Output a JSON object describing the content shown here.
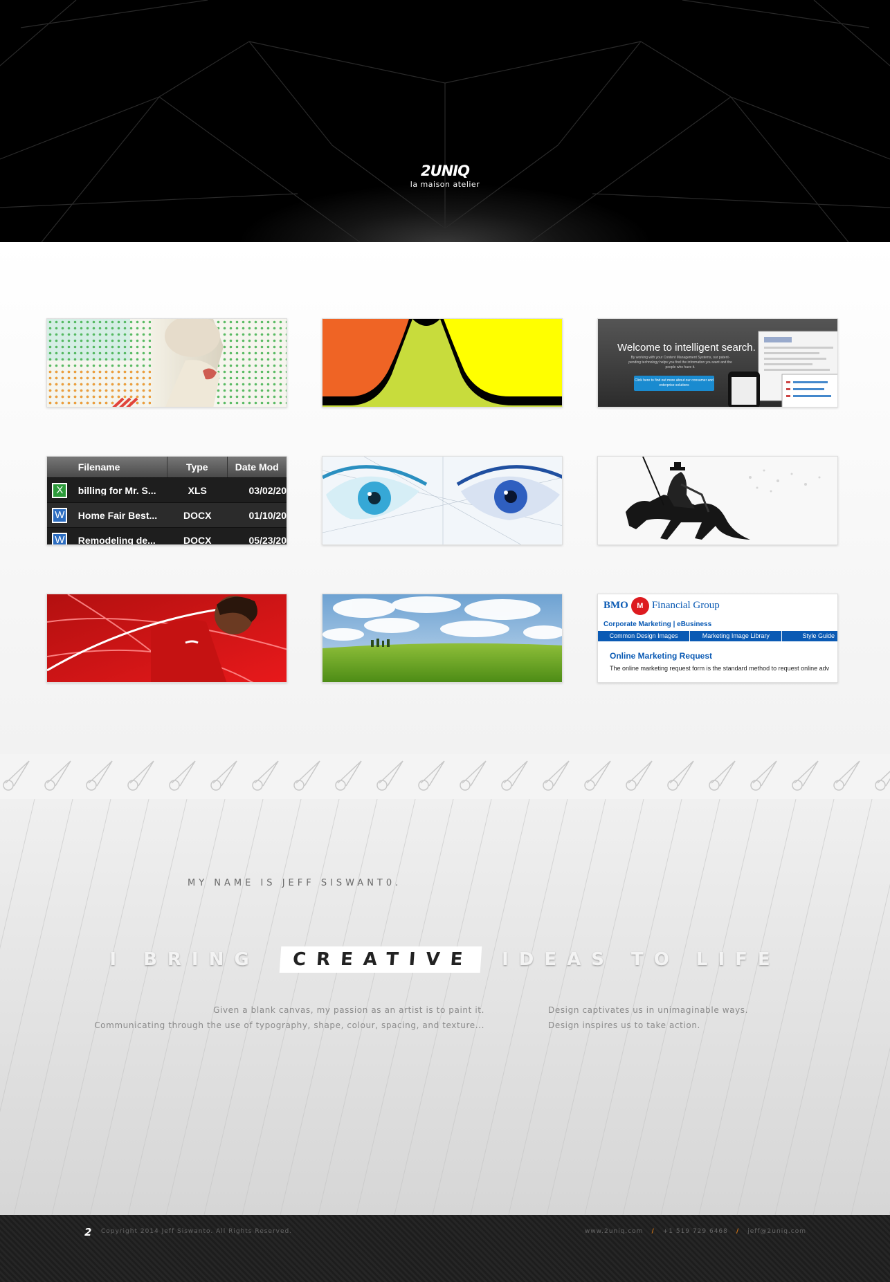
{
  "brand": {
    "logo": "2UNIQ",
    "tagline": "la maison atelier"
  },
  "portfolio": {
    "file_table": {
      "headers": [
        "Filename",
        "Type",
        "Date Mod"
      ],
      "rows": [
        {
          "icon": "X",
          "name": "billing for Mr. S...",
          "type": "XLS",
          "date": "03/02/20"
        },
        {
          "icon": "W",
          "name": "Home Fair Best...",
          "type": "DOCX",
          "date": "01/10/20"
        },
        {
          "icon": "W",
          "name": "Remodeling de...",
          "type": "DOCX",
          "date": "05/23/20"
        }
      ]
    },
    "search_ad": {
      "title": "Welcome to intelligent search.",
      "body": "By working with your Content Management Systems, our patent-pending technology helps you find the information you want and the people who have it.",
      "button": "Click here to find out more about our consumer and enterprise solutions"
    },
    "bmo": {
      "name1": "BMO",
      "badge": "M",
      "name2": "Financial Group",
      "subtitle": "Corporate Marketing | eBusiness",
      "nav": [
        "Common Design Images",
        "Marketing Image Library",
        "Style Guide"
      ],
      "heading": "Online Marketing Request",
      "text": "The online marketing request form is the standard method to request online adv"
    }
  },
  "about": {
    "name": "MY NAME IS JEFF SISWANT0.",
    "tag_before": "I BRING",
    "tag_highlight": "CREATIVE",
    "tag_after": "IDEAS TO LIFE",
    "left_1": "Given a blank canvas, my passion as an artist is to paint it.",
    "left_2": "Communicating through the use of typography, shape, colour, spacing, and texture...",
    "right_1": "Design captivates us in unimaginable ways.",
    "right_2": "Design inspires us to take action."
  },
  "footer": {
    "logo": "2",
    "copyright": "Copyright 2014 Jeff Siswanto. All Rights Reserved.",
    "website": "www.2uniq.com",
    "phone": "+1 519 729 6468",
    "email": "jeff@2uniq.com"
  },
  "colors": {
    "accent": "#e07a12",
    "bmo_blue": "#0a5ab4",
    "bmo_red": "#dd1a1f"
  }
}
